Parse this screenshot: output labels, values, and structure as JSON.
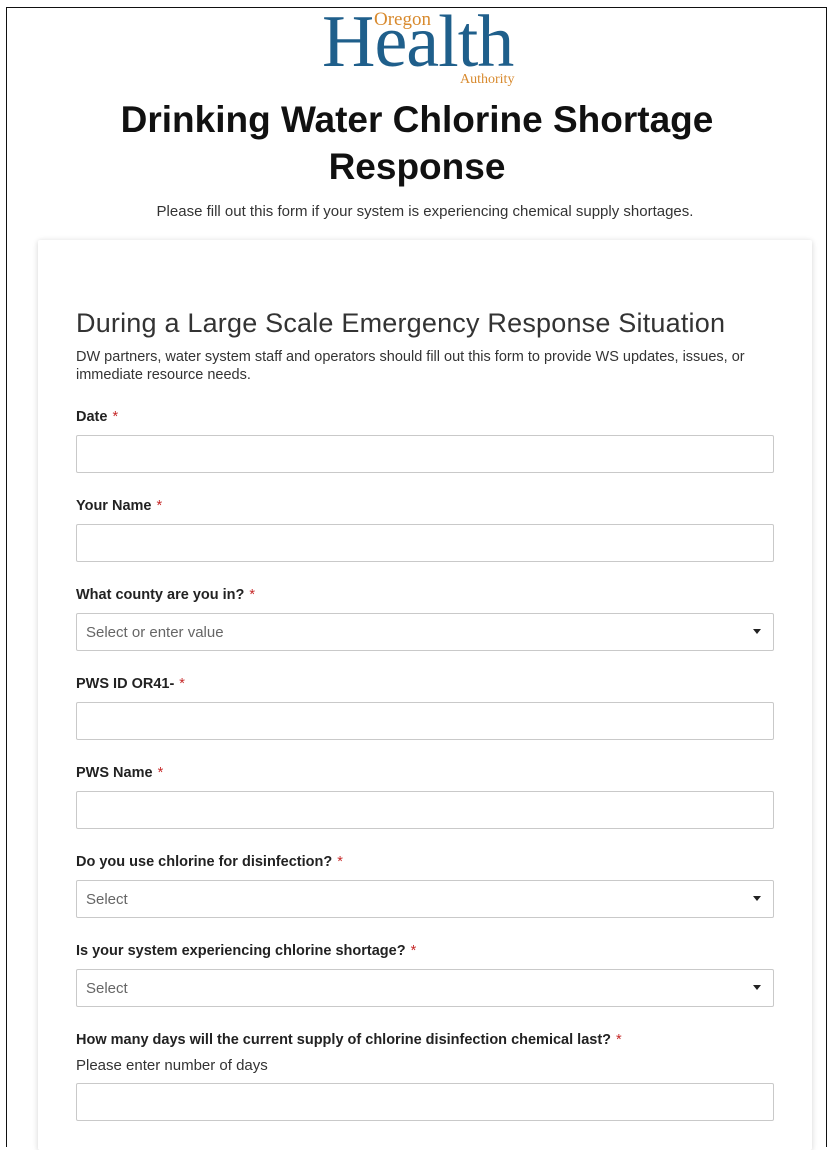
{
  "logo": {
    "main": "Health",
    "top": "Oregon",
    "bottom": "Authority"
  },
  "header": {
    "title_line1": "Drinking Water Chlorine Shortage",
    "title_line2": "Response",
    "subtitle": "Please fill out this form if your system is experiencing chemical supply shortages."
  },
  "section": {
    "title": "During a Large Scale Emergency Response Situation",
    "description": "DW partners, water system staff and operators should fill out this form to provide WS updates, issues, or immediate resource needs."
  },
  "required_marker": "*",
  "fields": [
    {
      "label": "Date",
      "type": "text"
    },
    {
      "label": "Your Name",
      "type": "text"
    },
    {
      "label": "What county are you in?",
      "type": "select",
      "placeholder": "Select or enter value"
    },
    {
      "label": "PWS ID OR41-",
      "type": "text"
    },
    {
      "label": "PWS Name",
      "type": "text"
    },
    {
      "label": "Do you use chlorine for disinfection?",
      "type": "select",
      "placeholder": "Select"
    },
    {
      "label": "Is your system experiencing chlorine shortage?",
      "type": "select",
      "placeholder": "Select"
    },
    {
      "label": "How many days will the current supply of chlorine disinfection chemical last?",
      "type": "text",
      "help": "Please enter number of days"
    }
  ],
  "colors": {
    "logo_blue": "#1f5f8b",
    "logo_orange": "#d88a2e",
    "required_red": "#c62828"
  }
}
